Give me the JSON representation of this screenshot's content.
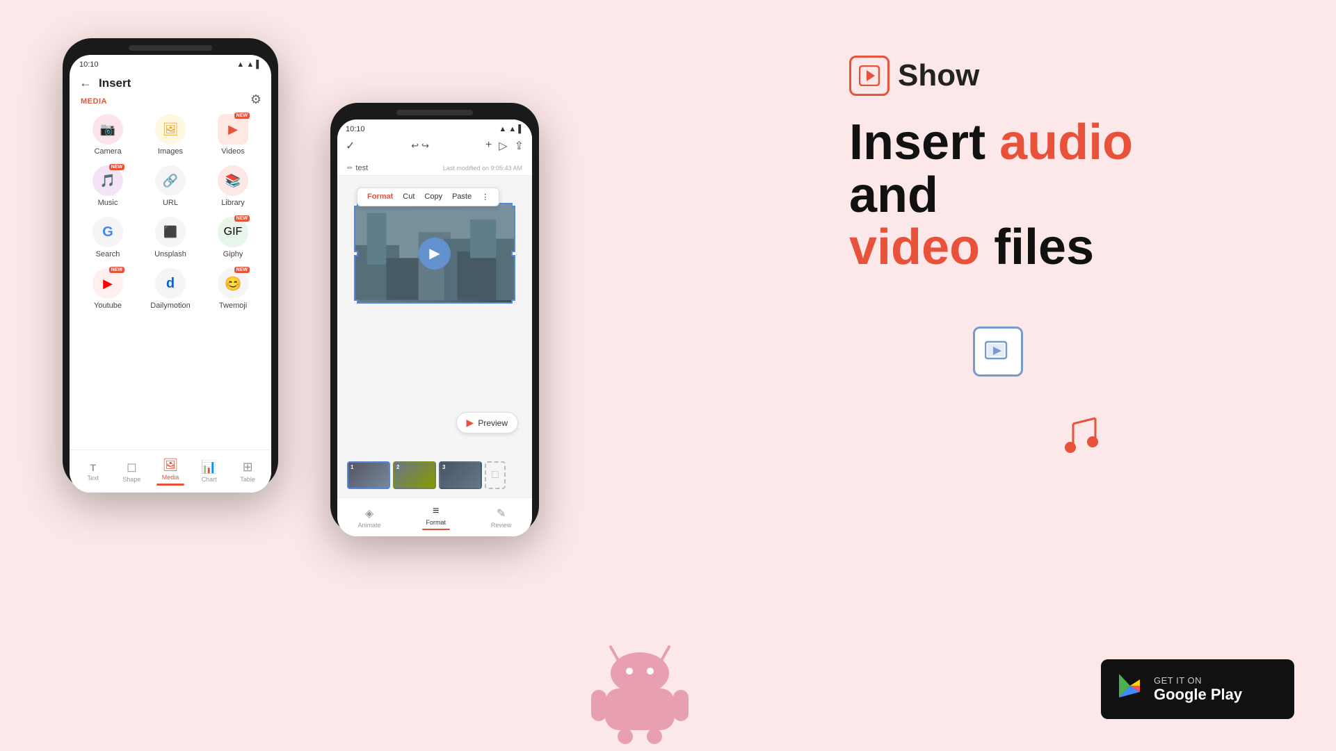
{
  "app": {
    "name": "Show",
    "tagline": "Insert audio and video files"
  },
  "left_phone": {
    "status_time": "10:10",
    "screen_title": "Insert",
    "section_media": "MEDIA",
    "grid_items": [
      {
        "id": "camera",
        "label": "Camera",
        "icon": "📷",
        "new": false
      },
      {
        "id": "images",
        "label": "Images",
        "icon": "🖼",
        "new": false
      },
      {
        "id": "videos",
        "label": "Videos",
        "icon": "▶",
        "new": true
      },
      {
        "id": "music",
        "label": "Music",
        "icon": "🎵",
        "new": true
      },
      {
        "id": "url",
        "label": "URL",
        "icon": "🔗",
        "new": false
      },
      {
        "id": "library",
        "label": "Library",
        "icon": "📚",
        "new": false
      },
      {
        "id": "search",
        "label": "Search",
        "icon": "G",
        "new": false
      },
      {
        "id": "unsplash",
        "label": "Unsplash",
        "icon": "⬛",
        "new": false
      },
      {
        "id": "giphy",
        "label": "Giphy",
        "icon": "🎬",
        "new": true
      },
      {
        "id": "youtube",
        "label": "Youtube",
        "icon": "▶",
        "new": true
      },
      {
        "id": "dailymotion",
        "label": "Dailymotion",
        "icon": "d",
        "new": false
      },
      {
        "id": "twemoji",
        "label": "Twemoji",
        "icon": "😊",
        "new": true
      }
    ],
    "nav_items": [
      {
        "id": "text",
        "label": "Text",
        "icon": "T",
        "active": false
      },
      {
        "id": "shape",
        "label": "Shape",
        "icon": "◻",
        "active": false
      },
      {
        "id": "media",
        "label": "Media",
        "icon": "🖼",
        "active": true
      },
      {
        "id": "chart",
        "label": "Chart",
        "icon": "📊",
        "active": false
      },
      {
        "id": "table",
        "label": "Table",
        "icon": "⊞",
        "active": false
      }
    ]
  },
  "right_phone": {
    "status_time": "10:10",
    "doc_title": "test",
    "last_modified": "Last modified on 9:05:43 AM",
    "context_menu": [
      "Format",
      "Cut",
      "Copy",
      "Paste",
      "⋮"
    ],
    "preview_label": "Preview",
    "bottom_tabs": [
      {
        "id": "animate",
        "label": "Animate",
        "active": false
      },
      {
        "id": "format",
        "label": "Format",
        "active": true
      },
      {
        "id": "review",
        "label": "Review",
        "active": false
      }
    ]
  },
  "headline": {
    "show_label": "Show",
    "line1": "Insert",
    "line1_accent": "audio",
    "line2": "and",
    "line3_prefix": "",
    "line3_accent": "video",
    "line3_suffix": " files"
  },
  "google_play": {
    "get_it": "GET IT ON",
    "store": "Google Play"
  }
}
